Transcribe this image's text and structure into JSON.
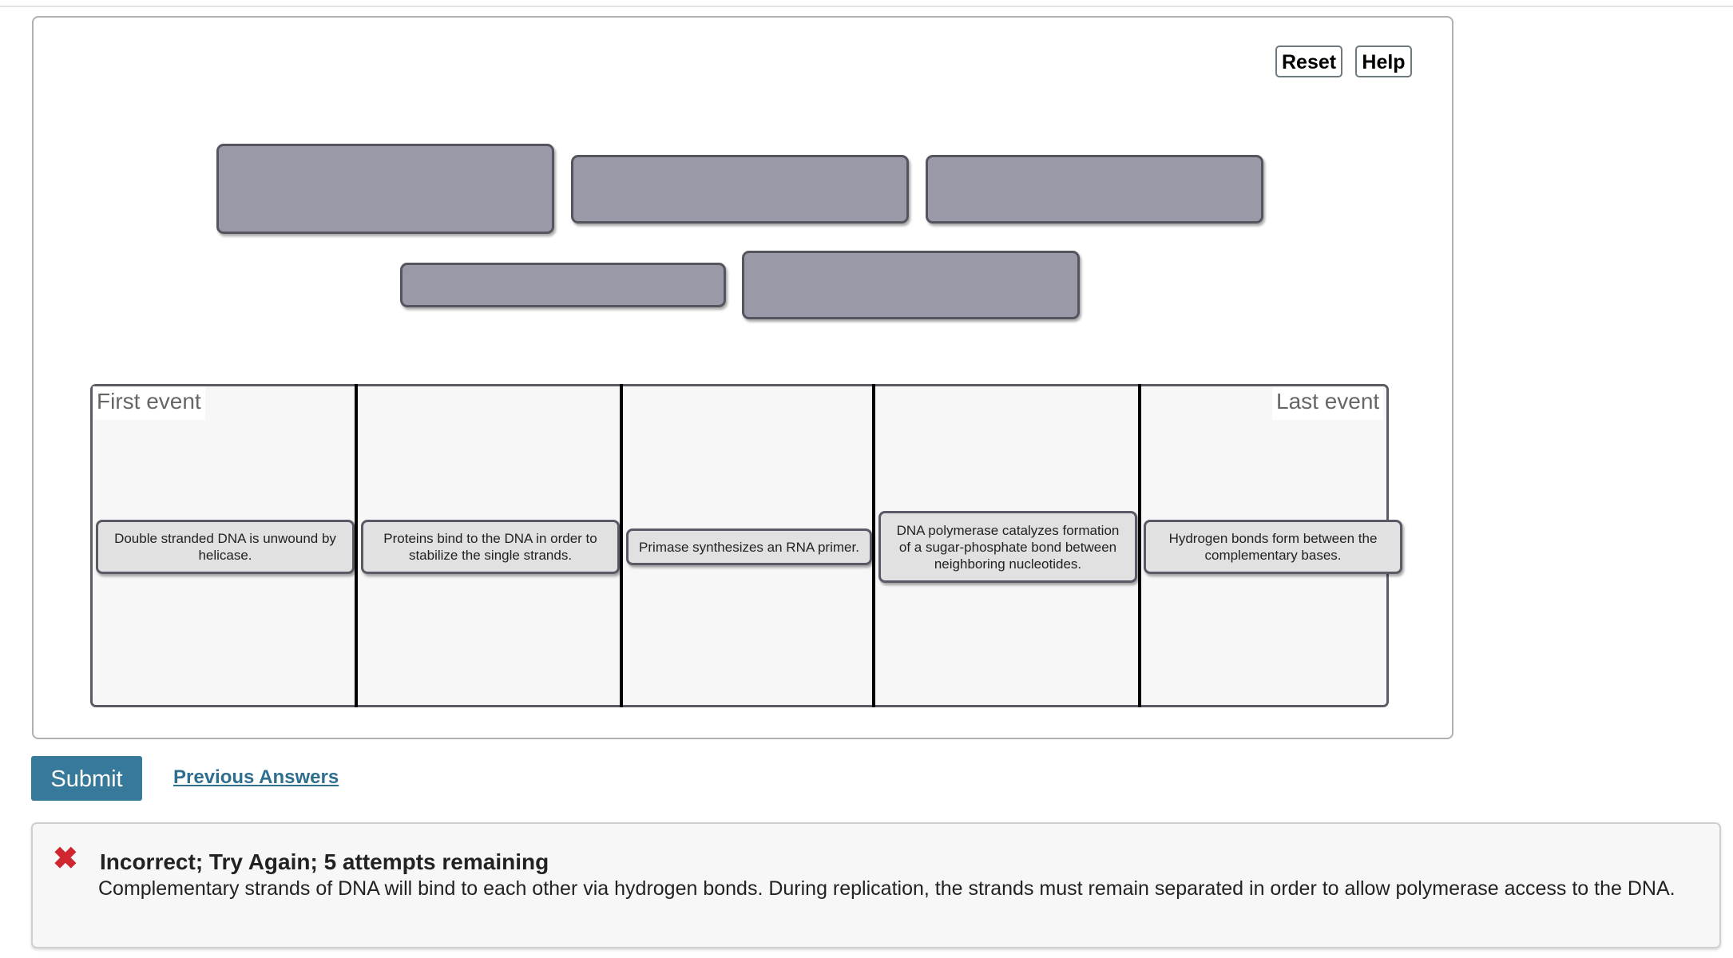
{
  "toolbar": {
    "reset_label": "Reset",
    "help_label": "Help"
  },
  "answer_bank": {
    "slots": [
      {
        "label": "",
        "state": "empty"
      },
      {
        "label": "",
        "state": "empty"
      },
      {
        "label": "",
        "state": "empty"
      },
      {
        "label": "",
        "state": "empty"
      },
      {
        "label": "",
        "state": "empty"
      }
    ]
  },
  "timeline": {
    "first_label": "First event",
    "last_label": "Last event",
    "cards": [
      {
        "text": "Double stranded DNA is unwound by helicase."
      },
      {
        "text": "Proteins bind to the DNA in order to stabilize the single strands."
      },
      {
        "text": "Primase synthesizes an RNA primer."
      },
      {
        "text": "DNA polymerase catalyzes formation of a sugar-phosphate bond between neighboring nucleotides."
      },
      {
        "text": "Hydrogen bonds form between the complementary bases."
      }
    ]
  },
  "actions": {
    "submit_label": "Submit",
    "previous_answers_label": "Previous Answers"
  },
  "feedback": {
    "icon": "x-mark-icon",
    "status_color": "#d0262f",
    "title": "Incorrect; Try Again; 5 attempts remaining",
    "message": "Complementary strands of DNA will bind to each other via hydrogen bonds. During replication, the strands must remain separated in order to allow polymerase access to the DNA."
  },
  "colors": {
    "submit_button": "#37799a",
    "link": "#2e6f90",
    "empty_slot": "#9a99a8",
    "card_fill": "#e1e1e1"
  }
}
